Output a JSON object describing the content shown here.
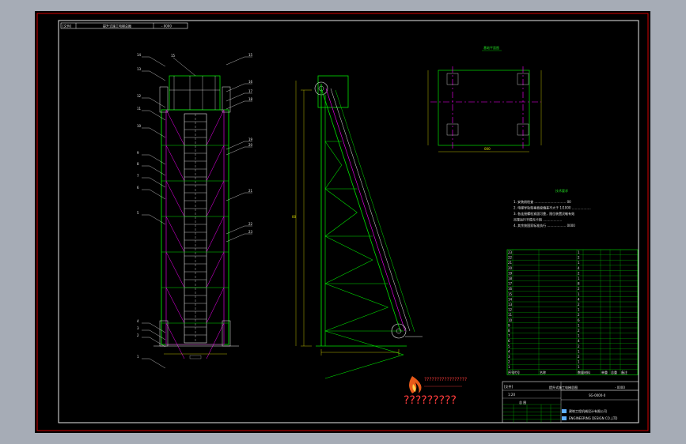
{
  "title_bar": {
    "label": "[文件]",
    "title": "提升式施工电梯总图",
    "number": "- 0000"
  },
  "front_view": {
    "callouts_left": [
      "14",
      "13",
      "12",
      "11",
      "10",
      "9",
      "8",
      "7",
      "6",
      "5",
      "4",
      "3",
      "2",
      "1"
    ],
    "callouts_right": [
      "15",
      "16",
      "17",
      "18",
      "19",
      "20",
      "21",
      "22",
      "23"
    ],
    "top_label": "15"
  },
  "side_view": {
    "dim_label": "00"
  },
  "plan_view": {
    "title": "基础平面图",
    "dim_label": "000"
  },
  "tech_notes": {
    "title": "技术要求",
    "lines": [
      "1. 安装前检查 ………………………… 00",
      "2. 电梯导轨架垂直度偏差不大于 1/1000 ………………",
      "3. 各连接螺栓紧固可靠，限位装置灵敏有效",
      "   吊笼运行平稳无卡阻 ………………",
      "4. 其余按国家标准执行 ……………… 0000"
    ]
  },
  "bom": {
    "headers": [
      "序号",
      "代号",
      "名称",
      "数量",
      "材料",
      "单重",
      "总重",
      "备注"
    ],
    "rows": [
      [
        "23",
        "",
        "",
        "1",
        "",
        "",
        "",
        ""
      ],
      [
        "22",
        "",
        "",
        "2",
        "",
        "",
        "",
        ""
      ],
      [
        "21",
        "",
        "",
        "1",
        "",
        "",
        "",
        ""
      ],
      [
        "20",
        "",
        "",
        "4",
        "",
        "",
        "",
        ""
      ],
      [
        "19",
        "",
        "",
        "2",
        "",
        "",
        "",
        ""
      ],
      [
        "18",
        "",
        "",
        "1",
        "",
        "",
        "",
        ""
      ],
      [
        "17",
        "",
        "",
        "8",
        "",
        "",
        "",
        ""
      ],
      [
        "16",
        "",
        "",
        "2",
        "",
        "",
        "",
        ""
      ],
      [
        "15",
        "",
        "",
        "1",
        "",
        "",
        "",
        ""
      ],
      [
        "14",
        "",
        "",
        "4",
        "",
        "",
        "",
        ""
      ],
      [
        "13",
        "",
        "",
        "2",
        "",
        "",
        "",
        ""
      ],
      [
        "12",
        "",
        "",
        "1",
        "",
        "",
        "",
        ""
      ],
      [
        "11",
        "",
        "",
        "2",
        "",
        "",
        "",
        ""
      ],
      [
        "10",
        "",
        "",
        "6",
        "",
        "",
        "",
        ""
      ],
      [
        "9",
        "",
        "",
        "1",
        "",
        "",
        "",
        ""
      ],
      [
        "8",
        "",
        "",
        "2",
        "",
        "",
        "",
        ""
      ],
      [
        "7",
        "",
        "",
        "1",
        "",
        "",
        "",
        ""
      ],
      [
        "6",
        "",
        "",
        "4",
        "",
        "",
        "",
        ""
      ],
      [
        "5",
        "",
        "",
        "2",
        "",
        "",
        "",
        ""
      ],
      [
        "4",
        "",
        "",
        "1",
        "",
        "",
        "",
        ""
      ],
      [
        "3",
        "",
        "",
        "2",
        "",
        "",
        "",
        ""
      ],
      [
        "2",
        "",
        "",
        "1",
        "",
        "",
        "",
        ""
      ],
      [
        "1",
        "",
        "",
        "1",
        "",
        "",
        "",
        ""
      ]
    ]
  },
  "title_block": {
    "file_label": "[文件]",
    "drawing_name": "提升式施工电梯总图",
    "number": "- 0000",
    "scale": "1:20",
    "drawing_no": "SG-0000-0",
    "sheet": "总 图",
    "company_line1": "建筑工程机械设计有限公司",
    "company_line2": "ENGINEERING DESIGN CO.,LTD"
  },
  "watermark": {
    "text": "?????????",
    "small_text": "?????????????????"
  },
  "colors": {
    "sheet": "#000000",
    "frame": "#e8e8e8",
    "border_red": "#d40000",
    "green": "#00e000",
    "magenta": "#ff00ff",
    "yellow": "#e6e600",
    "white": "#e8e8e8"
  }
}
